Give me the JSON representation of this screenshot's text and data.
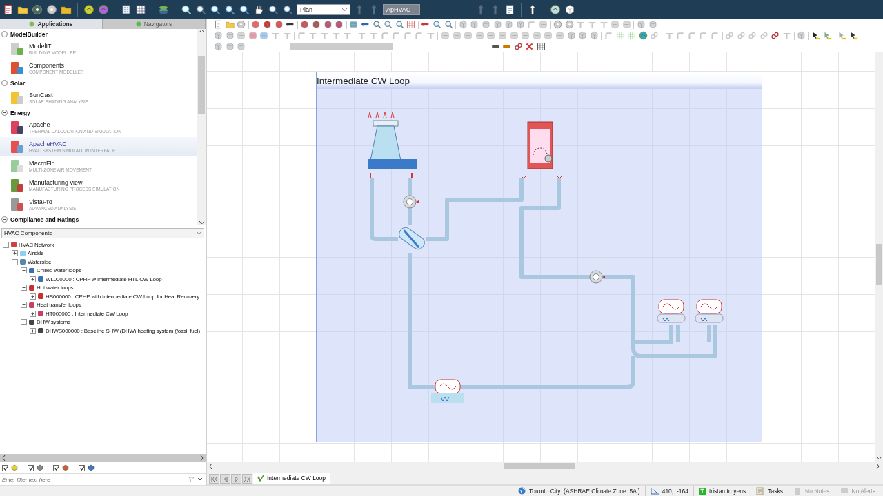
{
  "top_toolbar": {
    "view_dropdown": {
      "value": "Plan"
    },
    "app_dropdown": {
      "value": "ApHVAC",
      "disabled": true
    }
  },
  "sidebar": {
    "tabs": [
      {
        "label": "Applications",
        "selected": true
      },
      {
        "label": "Navigators",
        "selected": false
      }
    ],
    "app_groups": [
      {
        "title": "ModelBuilder",
        "expanded": true,
        "items": [
          {
            "kind": "building",
            "name": "ModelIT",
            "subtitle": "BUILDING MODELLER",
            "selected": false
          },
          {
            "kind": "components",
            "name": "Components",
            "subtitle": "COMPONENT MODELLER",
            "selected": false
          }
        ]
      },
      {
        "title": "Solar",
        "expanded": true,
        "items": [
          {
            "kind": "sun",
            "name": "SunCast",
            "subtitle": "SOLAR SHADING ANALYSIS",
            "selected": false
          }
        ]
      },
      {
        "title": "Energy",
        "expanded": true,
        "items": [
          {
            "kind": "apache",
            "name": "Apache",
            "subtitle": "THERMAL CALCULATION AND SIMULATION",
            "selected": false
          },
          {
            "kind": "hvac",
            "name": "ApacheHVAC",
            "subtitle": "HVAC SYSTEM SIMULATION INTERFACE",
            "selected": true
          },
          {
            "kind": "flow",
            "name": "MacroFlo",
            "subtitle": "MULTI-ZONE AIR MOVEMENT",
            "selected": false
          },
          {
            "kind": "gears",
            "name": "Manufacturing view",
            "subtitle": "MANUFACTURING PROCESS SIMULATION",
            "selected": false
          },
          {
            "kind": "chart",
            "name": "VistaPro",
            "subtitle": "ADVANCED ANALYSIS",
            "selected": false
          }
        ]
      },
      {
        "title": "Compliance and Ratings",
        "expanded": true
      }
    ],
    "component_dropdown": {
      "value": "HVAC Components"
    },
    "tree": [
      {
        "kind": "network",
        "label": "HVAC Network",
        "expanded": true,
        "children": [
          {
            "kind": "airside",
            "label": "Airside",
            "expanded": false
          },
          {
            "kind": "waterside",
            "label": "Waterside",
            "expanded": true,
            "children": [
              {
                "kind": "chilled",
                "label": "Chilled water loops",
                "expanded": true,
                "children": [
                  {
                    "kind": "chilled",
                    "label": "WL000000 : CPHP w Intermediate HTL CW Loop",
                    "expanded": false
                  }
                ]
              },
              {
                "kind": "hot",
                "label": "Hot water loops",
                "expanded": true,
                "children": [
                  {
                    "kind": "hot",
                    "label": "HS000000 : CPHP with Intermediate CW Loop for Heat Recovery",
                    "expanded": false
                  }
                ]
              },
              {
                "kind": "transfer",
                "label": "Heat transfer loops",
                "expanded": true,
                "children": [
                  {
                    "kind": "transfer",
                    "label": "HT000000 : Intermediate CW Loop",
                    "expanded": false
                  }
                ]
              },
              {
                "kind": "dhw",
                "label": "DHW systems",
                "expanded": true,
                "children": [
                  {
                    "kind": "dhw",
                    "label": "DHWS000000 : Baseline SHW (DHW) heating system (fossil fuel)",
                    "expanded": false
                  }
                ]
              }
            ]
          }
        ]
      }
    ],
    "filter_checkboxes": [
      {
        "kind": "yellow",
        "checked": true
      },
      {
        "kind": "grey",
        "checked": true
      },
      {
        "kind": "orange",
        "checked": true
      },
      {
        "kind": "blue",
        "checked": true
      }
    ],
    "filter_field": {
      "placeholder": "Enter filter text here"
    }
  },
  "diagram": {
    "loop_title": "Intermediate CW Loop"
  },
  "page_tabs": [
    {
      "label": "Intermediate CW Loop",
      "selected": true
    }
  ],
  "status_bar": {
    "location": "Toronto City  (ASHRAE Climate Zone: 5A )",
    "coordinates": "410,  -164",
    "user": "tristan.truyens",
    "items": [
      {
        "kind": "tasks",
        "label": "Tasks",
        "disabled": false
      },
      {
        "kind": "notes",
        "label": "No Notes",
        "disabled": true
      },
      {
        "kind": "alerts",
        "label": "No Alerts",
        "disabled": true
      }
    ]
  }
}
